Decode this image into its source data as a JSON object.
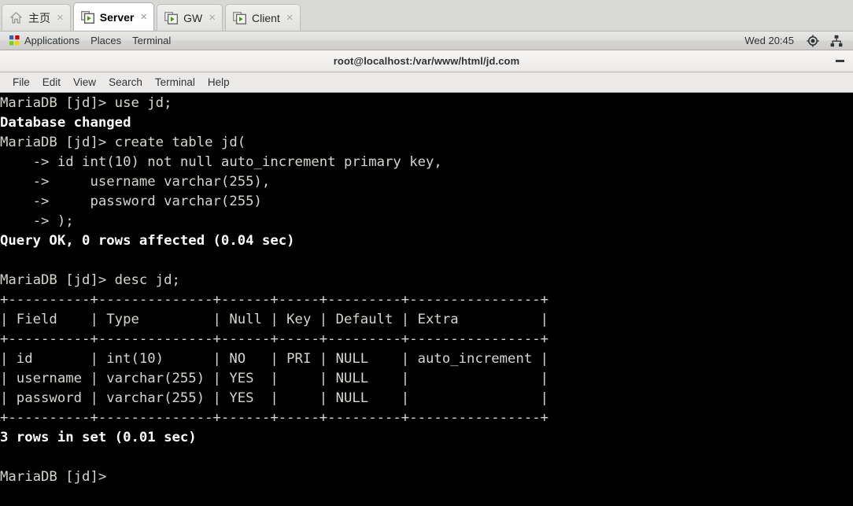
{
  "tabstrip": {
    "tabs": [
      {
        "label": "主页",
        "icon": "home-icon",
        "active": false,
        "close_label": "×"
      },
      {
        "label": "Server",
        "icon": "terminal-run-icon",
        "active": true,
        "close_label": "×"
      },
      {
        "label": "GW",
        "icon": "terminal-run-icon",
        "active": false,
        "close_label": "×"
      },
      {
        "label": "Client",
        "icon": "terminal-run-icon",
        "active": false,
        "close_label": "×"
      }
    ]
  },
  "panel": {
    "applications_label": "Applications",
    "places_label": "Places",
    "terminal_label": "Terminal",
    "clock": "Wed 20:45",
    "icons": [
      "fedora-logo-icon",
      "volume-icon",
      "network-wired-icon"
    ]
  },
  "window": {
    "title": "root@localhost:/var/www/html/jd.com",
    "minimize_label": "–"
  },
  "menubar": {
    "items": [
      "File",
      "Edit",
      "View",
      "Search",
      "Terminal",
      "Help"
    ]
  },
  "terminal": {
    "prompt": "MariaDB [jd]> ",
    "continuation": "    -> ",
    "lines": [
      {
        "text": "MariaDB [jd]> use jd;",
        "bold": false
      },
      {
        "text": "Database changed",
        "bold": true
      },
      {
        "text": "MariaDB [jd]> create table jd(",
        "bold": false
      },
      {
        "text": "    -> id int(10) not null auto_increment primary key,",
        "bold": false
      },
      {
        "text": "    ->     username varchar(255),",
        "bold": false
      },
      {
        "text": "    ->     password varchar(255)",
        "bold": false
      },
      {
        "text": "    -> );",
        "bold": false
      },
      {
        "text": "Query OK, 0 rows affected (0.04 sec)",
        "bold": true
      },
      {
        "text": "",
        "bold": false
      },
      {
        "text": "MariaDB [jd]> desc jd;",
        "bold": false
      },
      {
        "text": "+----------+--------------+------+-----+---------+----------------+",
        "bold": false
      },
      {
        "text": "| Field    | Type         | Null | Key | Default | Extra          |",
        "bold": false
      },
      {
        "text": "+----------+--------------+------+-----+---------+----------------+",
        "bold": false
      },
      {
        "text": "| id       | int(10)      | NO   | PRI | NULL    | auto_increment |",
        "bold": false
      },
      {
        "text": "| username | varchar(255) | YES  |     | NULL    |                |",
        "bold": false
      },
      {
        "text": "| password | varchar(255) | YES  |     | NULL    |                |",
        "bold": false
      },
      {
        "text": "+----------+--------------+------+-----+---------+----------------+",
        "bold": false
      },
      {
        "text": "3 rows in set (0.01 sec)",
        "bold": true
      },
      {
        "text": "",
        "bold": false
      },
      {
        "text": "MariaDB [jd]>",
        "bold": false
      }
    ],
    "desc_table": {
      "columns": [
        "Field",
        "Type",
        "Null",
        "Key",
        "Default",
        "Extra"
      ],
      "rows": [
        [
          "id",
          "int(10)",
          "NO",
          "PRI",
          "NULL",
          "auto_increment"
        ],
        [
          "username",
          "varchar(255)",
          "YES",
          "",
          "NULL",
          ""
        ],
        [
          "password",
          "varchar(255)",
          "YES",
          "",
          "NULL",
          ""
        ]
      ],
      "row_count_text": "3 rows in set (0.01 sec)"
    },
    "colors": {
      "background": "#000000",
      "foreground": "#d3d7cf",
      "bold_foreground": "#ffffff"
    }
  }
}
